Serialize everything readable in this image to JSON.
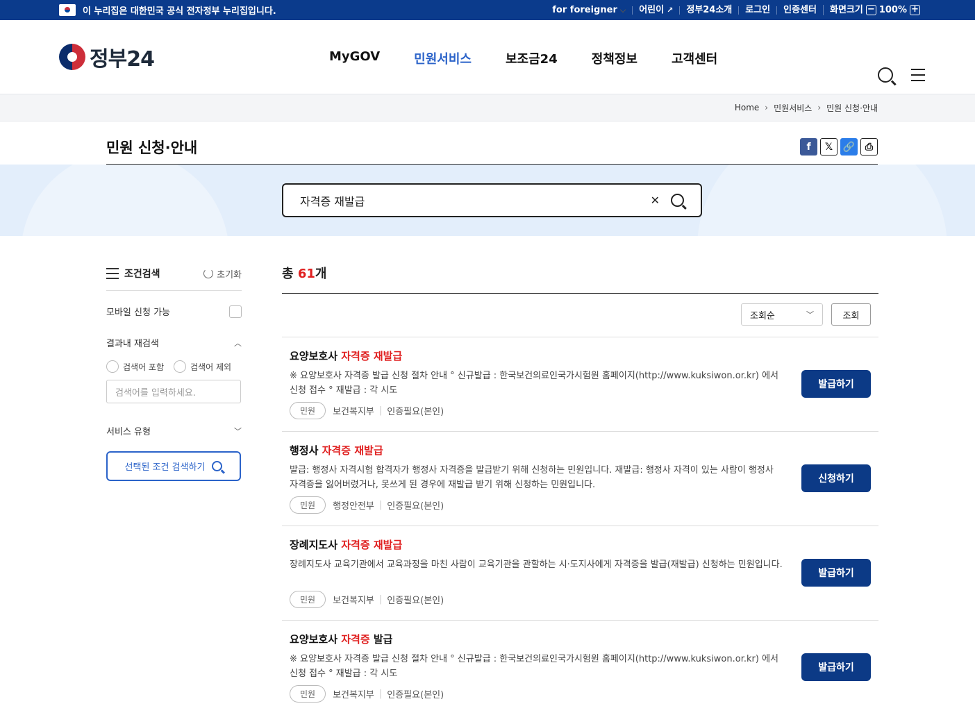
{
  "topbar": {
    "notice": "이 누리집은 대한민국 공식 전자정부 누리집입니다.",
    "links": [
      "for foreigner",
      "어린이",
      "정부24소개",
      "로그인",
      "인증센터",
      "화면크기"
    ],
    "zoom": "100%"
  },
  "header": {
    "logo_text": "정부24",
    "nav": [
      "MyGOV",
      "민원서비스",
      "보조금24",
      "정책정보",
      "고객센터"
    ],
    "active_nav": "민원서비스"
  },
  "breadcrumb": [
    "Home",
    "민원서비스",
    "민원 신청·안내"
  ],
  "page_title": "민원 신청·안내",
  "search": {
    "value": "자격증 재발급"
  },
  "sidebar": {
    "title": "조건검색",
    "reset": "초기화",
    "mobile": "모바일 신청 가능",
    "refine": "결과내 재검색",
    "include": "검색어 포함",
    "exclude": "검색어 제외",
    "input_placeholder": "검색어를 입력하세요.",
    "service_type": "서비스 유형",
    "search_btn": "선택된 조건 검색하기"
  },
  "results": {
    "total_prefix": "총",
    "total_count": "61",
    "total_suffix": "개",
    "sort": "조회순",
    "sort_btn": "조회",
    "items": [
      {
        "title_pre": "요양보호사 ",
        "title_hl": "자격증 재발급",
        "title_post": "",
        "desc": "※ 요양보호사 자격증 발급 신청 절차 안내 ° 신규발급 : 한국보건의료인국가시험원 홈페이지(http://www.kuksiwon.or.kr) 에서 신청 접수 ° 재발급 : 각 시도",
        "tag": "민원",
        "dept": "보건복지부",
        "auth": "인증필요(본인)",
        "button": "발급하기"
      },
      {
        "title_pre": "행정사 ",
        "title_hl": "자격증 재발급",
        "title_post": "",
        "desc": "발급: 행정사 자격시험 합격자가 행정사 자격증을 발급받기 위해 신청하는 민원입니다. 재발급: 행정사 자격이 있는 사람이 행정사 자격증을 잃어버렸거나, 못쓰게 된 경우에 재발급 받기 위해 신청하는 민원입니다.",
        "tag": "민원",
        "dept": "행정안전부",
        "auth": "인증필요(본인)",
        "button": "신청하기"
      },
      {
        "title_pre": "장례지도사 ",
        "title_hl": "자격증 재발급",
        "title_post": "",
        "desc": "장례지도사 교육기관에서 교육과정을 마친 사람이 교육기관을 관할하는 시·도지사에게 자격증을 발급(재발급) 신청하는 민원입니다.",
        "tag": "민원",
        "dept": "보건복지부",
        "auth": "인증필요(본인)",
        "button": "발급하기"
      },
      {
        "title_pre": "요양보호사 ",
        "title_hl": "자격증",
        "title_post": " 발급",
        "desc": "※ 요양보호사 자격증 발급 신청 절차 안내 ° 신규발급 : 한국보건의료인국가시험원 홈페이지(http://www.kuksiwon.or.kr) 에서 신청 접수 ° 재발급 : 각 시도",
        "tag": "민원",
        "dept": "보건복지부",
        "auth": "인증필요(본인)",
        "button": "발급하기"
      }
    ]
  }
}
